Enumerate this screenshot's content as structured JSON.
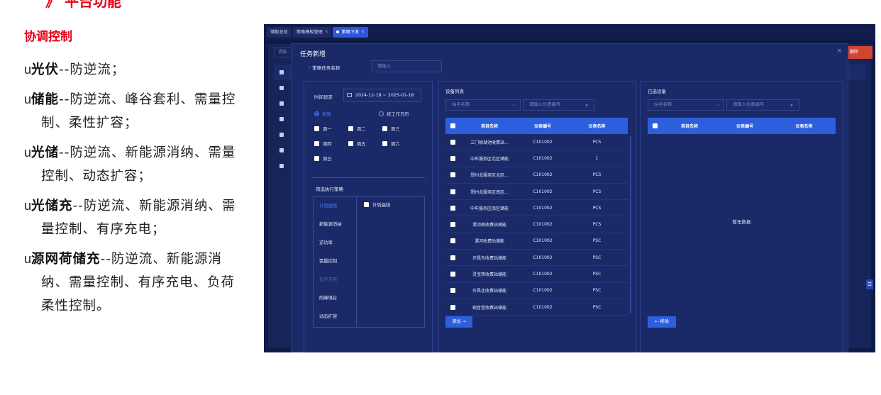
{
  "slide": {
    "section_title": "》 平台功能",
    "sub_title": "协调控制",
    "bullets": [
      {
        "marker": "u",
        "name": "光伏",
        "desc": "--防逆流；"
      },
      {
        "marker": "u",
        "name": "储能",
        "desc": "--防逆流、峰谷套利、需量控制、柔性扩容；"
      },
      {
        "marker": "u",
        "name": "光储",
        "desc": "--防逆流、新能源消纳、需量控制、动态扩容；"
      },
      {
        "marker": "u",
        "name": "光储充",
        "desc": "--防逆流、新能源消纳、需量控制、有序充电；"
      },
      {
        "marker": "u",
        "name": "源网荷储充",
        "desc": "--防逆流、新能源消纳、需量控制、有序充电、负荷柔性控制。"
      }
    ]
  },
  "app": {
    "tabs": [
      {
        "label": "储能总览",
        "close": ""
      },
      {
        "label": "策略模板管理",
        "close": "×"
      },
      {
        "label": "策略下发",
        "close": "×"
      }
    ],
    "background": {
      "search_placeholder": "请输...",
      "delete_label": "删除",
      "side_filter_icon": "filter-icon"
    },
    "dialog": {
      "title": "任务新增",
      "close": "×",
      "name_label": "策略任务名称",
      "name_required": "*",
      "name_placeholder": "请输入",
      "left": {
        "time_label": "时间设定",
        "date_range": "2024-12-18  ~  2025-01-18",
        "radio_by_week": "按周",
        "radio_by_calendar": "按工作日历",
        "weekdays": [
          "周一",
          "周二",
          "周三",
          "周四",
          "周五",
          "周六",
          "周日"
        ],
        "strategy_label": "筛选执行策略",
        "strategies": [
          {
            "label": "计划曲线",
            "state": "active"
          },
          {
            "label": "新能源消纳",
            "state": "normal"
          },
          {
            "label": "逆功率",
            "state": "normal"
          },
          {
            "label": "需量控制",
            "state": "normal"
          },
          {
            "label": "有序充电",
            "state": "disabled"
          },
          {
            "label": "削峰填谷",
            "state": "normal"
          },
          {
            "label": "动态扩容",
            "state": "normal"
          }
        ],
        "curve_option": "计划曲线"
      },
      "device_list": {
        "title": "设备列表",
        "station_placeholder": "站点名称",
        "meter_placeholder": "请输入仪表编号",
        "columns": [
          "项目名称",
          "仪表编号",
          "仪表名称"
        ],
        "rows": [
          [
            "三门峡湖池收费站...",
            "C101002",
            "PCS"
          ],
          [
            "中牟服务区北区储能",
            "C101002",
            "1"
          ],
          [
            "郑州北服务区北区...",
            "C101002",
            "PCS"
          ],
          [
            "郑州北服务区南区...",
            "C101002",
            "PCS"
          ],
          [
            "中牟服务区南区储能",
            "C101002",
            "PCS"
          ],
          [
            "漯河南收费站储能",
            "C101002",
            "PCS"
          ],
          [
            "漯河收费站储能",
            "C101002",
            "PSC"
          ],
          [
            "许昌东收费站储能",
            "C101002",
            "PSC"
          ],
          [
            "灵宝西收费站储能",
            "C101002",
            "PSC"
          ],
          [
            "许昌北收费站储能",
            "C101002",
            "PSC"
          ],
          [
            "观音堂收费站储能",
            "C101002",
            "PSC"
          ]
        ],
        "add_button": "添加 →"
      },
      "selected": {
        "title": "已选设备",
        "station_placeholder": "站点名称",
        "meter_placeholder": "请输入仪表编号",
        "columns": [
          "项目名称",
          "仪表编号",
          "仪表名称"
        ],
        "empty_text": "暂无数据",
        "remove_button": "← 移除"
      }
    }
  }
}
